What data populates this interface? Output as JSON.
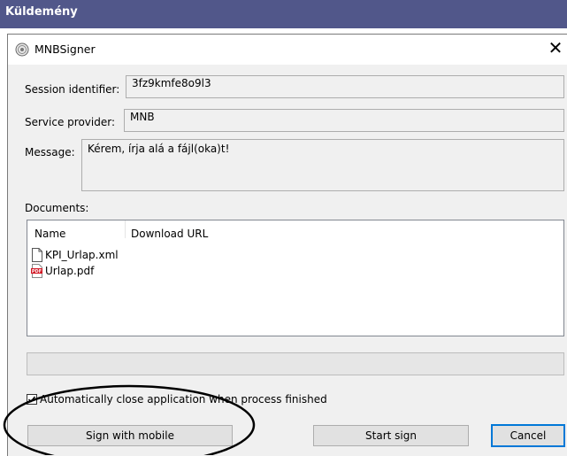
{
  "outer_window": {
    "title": "Küldemény"
  },
  "dialog": {
    "title": "MNBSigner",
    "close_glyph": "✕",
    "session": {
      "label": "Session identifier:",
      "value": "3fz9kmfe8o9l3"
    },
    "provider": {
      "label": "Service provider:",
      "value": "MNB"
    },
    "message": {
      "label": "Message:",
      "value": "Kérem, írja alá a fájl(oka)t!"
    },
    "documents": {
      "label": "Documents:",
      "columns": [
        "Name",
        "Download URL"
      ],
      "rows": [
        {
          "name": "KPI_Urlap.xml",
          "icon": "file-icon"
        },
        {
          "name": "Urlap.pdf",
          "icon": "pdf-icon"
        }
      ]
    },
    "progress": 0,
    "auto_close": {
      "label": "Automatically close application when process finished",
      "checked": true
    },
    "buttons": {
      "sign_mobile": "Sign with mobile",
      "start_sign": "Start sign",
      "cancel": "Cancel"
    },
    "pdf_badge": "PDF"
  }
}
